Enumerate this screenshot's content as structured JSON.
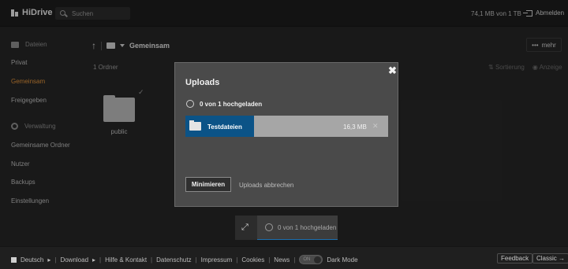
{
  "topbar": {
    "logo": "HiDrive",
    "search_placeholder": "Suchen",
    "quota": "74,1 MB von 1 TB",
    "logout": "Abmelden"
  },
  "sidebar": {
    "files_header": "Dateien",
    "items": [
      "Privat",
      "Gemeinsam",
      "Freigegeben"
    ],
    "active": "Gemeinsam",
    "admin_header": "Verwaltung",
    "admin_items": [
      "Gemeinsame Ordner",
      "Nutzer",
      "Backups",
      "Einstellungen"
    ]
  },
  "main": {
    "breadcrumb": "Gemeinsam",
    "more": "mehr",
    "count": "1 Ordner",
    "sort": "Sortierung",
    "view": "Anzeige",
    "folder_name": "public"
  },
  "modal": {
    "title": "Uploads",
    "status": "0 von 1 hochgeladen",
    "file": {
      "name": "Testdateien",
      "size": "16,3 MB",
      "progress": 0.34
    },
    "minimize": "Minimieren",
    "abort": "Uploads abbrechen"
  },
  "mini_widget": {
    "status": "0 von 1 hochgeladen"
  },
  "footer": {
    "language": "Deutsch",
    "links": [
      "Download",
      "Hilfe & Kontakt",
      "Datenschutz",
      "Impressum",
      "Cookies",
      "News"
    ],
    "toggle_state": "ON",
    "dark_mode": "Dark Mode",
    "feedback": "Feedback",
    "classic": "Classic"
  },
  "colors": {
    "accent_active": "#e0913a",
    "progress_blue": "#0b5387"
  }
}
